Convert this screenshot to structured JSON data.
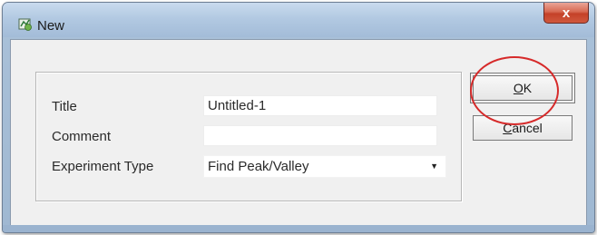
{
  "window": {
    "title": "New",
    "close_label": "x"
  },
  "form": {
    "title_label": "Title",
    "title_value": "Untitled-1",
    "comment_label": "Comment",
    "comment_value": "",
    "experiment_type_label": "Experiment Type",
    "experiment_type_value": "Find Peak/Valley"
  },
  "buttons": {
    "ok_label": "OK",
    "ok_mnemonic": "O",
    "ok_rest": "K",
    "cancel_label": "Cancel",
    "cancel_mnemonic": "C",
    "cancel_rest": "ancel"
  },
  "annotation": {
    "highlight_color": "#d62a2a"
  },
  "icons": {
    "title_icon": "app-icon",
    "dropdown_icon": "dropdown-arrow-icon"
  }
}
